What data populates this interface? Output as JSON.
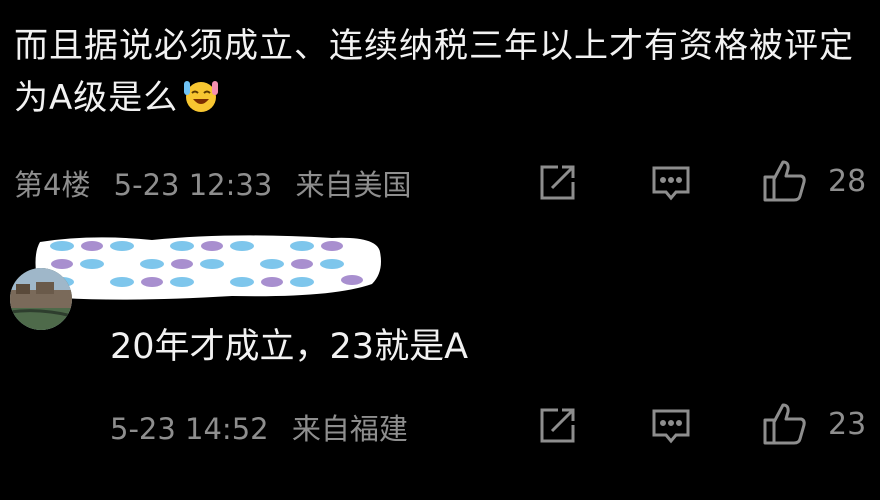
{
  "comment": {
    "text": "而且据说必须成立、连续纳税三年以上才有资格被评定为A级是么",
    "emoji": "grinning-sweat-emoji",
    "floor": "第4楼",
    "date": "5-23 12:33",
    "location": "来自美国",
    "likes": "28"
  },
  "reply": {
    "text": "20年才成立，23就是A",
    "date": "5-23 14:52",
    "location": "来自福建",
    "likes": "23"
  },
  "icons": {
    "share": "share-icon",
    "comment": "comment-icon",
    "like": "thumbs-up-icon"
  },
  "colors": {
    "background": "#000000",
    "text": "#f2f2f2",
    "meta": "#8e8e8e"
  }
}
